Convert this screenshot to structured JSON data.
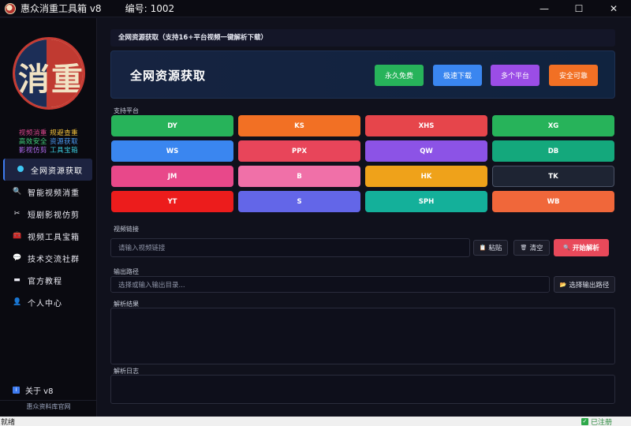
{
  "window": {
    "title": "惠众消重工具箱 v8",
    "id_label": "编号:",
    "id_value": "1002",
    "minimize": "—",
    "maximize": "☐",
    "close": "✕"
  },
  "sidebar": {
    "logo_left": "消",
    "logo_right": "重",
    "slogan": [
      [
        {
          "text": "视频消重",
          "color": "#d9468c"
        },
        {
          "text": "规避查重",
          "color": "#f3c13b"
        }
      ],
      [
        {
          "text": "高效安全",
          "color": "#42d27d"
        },
        {
          "text": "资源获取",
          "color": "#4c9cf5"
        }
      ],
      [
        {
          "text": "影视仿剪",
          "color": "#b26bf2"
        },
        {
          "text": "工具宝箱",
          "color": "#39c6d8"
        }
      ]
    ],
    "items": [
      {
        "label": "全网资源获取",
        "icon": "dot-icon",
        "glyph": ""
      },
      {
        "label": "智能视频消重",
        "icon": "magnifier-icon",
        "glyph": "🔍"
      },
      {
        "label": "短剧影视仿剪",
        "icon": "scissors-icon",
        "glyph": "✂"
      },
      {
        "label": "视频工具宝箱",
        "icon": "toolbox-icon",
        "glyph": "🧰"
      },
      {
        "label": "技术交流社群",
        "icon": "chat-icon",
        "glyph": "💬"
      },
      {
        "label": "官方教程",
        "icon": "monitor-icon",
        "glyph": "▬"
      },
      {
        "label": "个人中心",
        "icon": "user-icon",
        "glyph": "👤"
      }
    ],
    "about": "关于 v8",
    "about_icon": "i",
    "site_link": "惠众资料库官网"
  },
  "main": {
    "breadcrumb": "全网资源获取（支持16+平台视频一键解析下载）",
    "hero": {
      "title": "全网资源获取",
      "badges": [
        {
          "label": "永久免费",
          "color": "#27b35a"
        },
        {
          "label": "极速下载",
          "color": "#3a86f0"
        },
        {
          "label": "多个平台",
          "color": "#9b4de6"
        },
        {
          "label": "安全可靠",
          "color": "#f27024"
        }
      ]
    },
    "platforms_label": "支持平台",
    "platforms": [
      {
        "label": "DY",
        "color": "#27b35a"
      },
      {
        "label": "KS",
        "color": "#f27024"
      },
      {
        "label": "XHS",
        "color": "#e6454b"
      },
      {
        "label": "XG",
        "color": "#27b35a"
      },
      {
        "label": "WS",
        "color": "#3a86f0"
      },
      {
        "label": "PPX",
        "color": "#e8455a"
      },
      {
        "label": "QW",
        "color": "#8c53e6"
      },
      {
        "label": "DB",
        "color": "#14a87c"
      },
      {
        "label": "JM",
        "color": "#e8488a"
      },
      {
        "label": "B",
        "color": "#f070a8"
      },
      {
        "label": "HK",
        "color": "#efa21a"
      },
      {
        "label": "TK",
        "color": "#1e2433"
      },
      {
        "label": "YT",
        "color": "#ec1c1c"
      },
      {
        "label": "S",
        "color": "#6366e8"
      },
      {
        "label": "SPH",
        "color": "#14b09a"
      },
      {
        "label": "WB",
        "color": "#f0673a"
      }
    ],
    "video_link": {
      "label": "视频链接",
      "placeholder": "请输入视频链接",
      "paste": "粘贴",
      "paste_icon": "📋",
      "clear": "清空",
      "clear_icon": "🗑",
      "parse": "开始解析",
      "parse_icon": "🔍"
    },
    "output": {
      "label": "输出路径",
      "placeholder": "选择或输入输出目录...",
      "select": "选择输出路径",
      "select_icon": "📂"
    },
    "result_label": "解析结果",
    "log_label": "解析日志"
  },
  "statusbar": {
    "left": "就绪",
    "right": "已注册",
    "right_icon": "✓"
  }
}
